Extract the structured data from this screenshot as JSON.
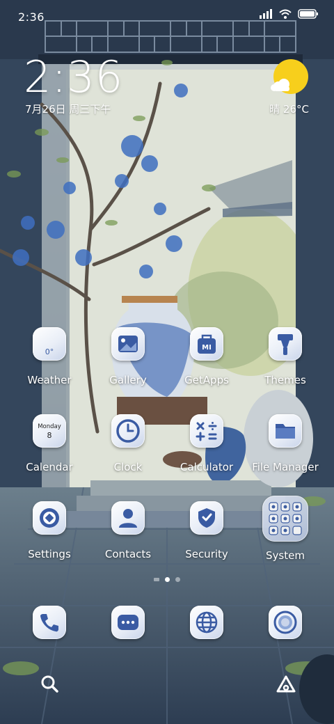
{
  "status_bar": {
    "time": "2:36"
  },
  "lock": {
    "time": "2:36",
    "date": "7月26日 周三下午",
    "weather": "晴 26°C"
  },
  "apps": [
    {
      "name": "weather",
      "label": "Weather",
      "icon": "weather-icon",
      "icon_text": "0°"
    },
    {
      "name": "gallery",
      "label": "Gallery",
      "icon": "gallery-icon"
    },
    {
      "name": "getapps",
      "label": "GetApps",
      "icon": "getapps-icon",
      "icon_text": "MI"
    },
    {
      "name": "themes",
      "label": "Themes",
      "icon": "themes-icon"
    },
    {
      "name": "calendar",
      "label": "Calendar",
      "icon": "calendar-icon",
      "icon_text": "Monday",
      "icon_num": "8"
    },
    {
      "name": "clock",
      "label": "Clock",
      "icon": "clock-icon"
    },
    {
      "name": "calculator",
      "label": "Calculator",
      "icon": "calculator-icon"
    },
    {
      "name": "file-manager",
      "label": "File Manager",
      "icon": "folder-icon"
    },
    {
      "name": "settings",
      "label": "Settings",
      "icon": "settings-icon"
    },
    {
      "name": "contacts",
      "label": "Contacts",
      "icon": "contacts-icon"
    },
    {
      "name": "security",
      "label": "Security",
      "icon": "shield-icon"
    },
    {
      "name": "system",
      "label": "System",
      "icon": "folder-grid-icon"
    }
  ],
  "dock": [
    {
      "name": "phone",
      "icon": "phone-icon"
    },
    {
      "name": "messages",
      "icon": "message-icon"
    },
    {
      "name": "browser",
      "icon": "globe-icon"
    },
    {
      "name": "camera",
      "icon": "camera-icon"
    }
  ],
  "colors": {
    "icon_blue": "#3a5ba3",
    "sun": "#f7cf1c"
  }
}
